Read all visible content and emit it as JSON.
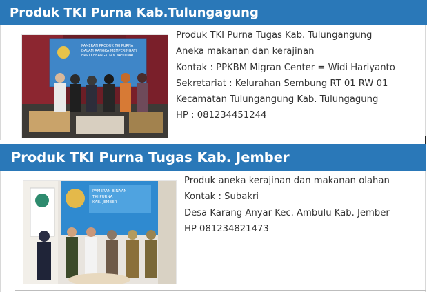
{
  "section1": {
    "title": "Produk TKI Purna Kab.Tulungagung",
    "lines": [
      "Produk TKI Purna Tugas Kab. Tulungangung",
      "Aneka makanan dan kerajinan",
      "Kontak : PPKBM Migran Center = Widi Hariyanto",
      "Sekretariat : Kelurahan Sembung RT 01 RW 01",
      "Kecamatan Tulungangung Kab. Tulungagung",
      "HP : 081234451244"
    ],
    "photo": {
      "banner_lines": [
        "PAMERAN PRODUK TKI PURNA",
        "DALAM RANGKA MEMPERINGATI",
        "HARI KEBANGKITAN NASIONAL"
      ],
      "icon": "exhibition-photo"
    }
  },
  "section2": {
    "title": "Produk TKI Purna Tugas Kab. Jember",
    "lines": [
      "Produk aneka kerajinan dan makanan olahan",
      "Kontak : Subakri",
      "Desa Karang Anyar Kec. Ambulu Kab. Jember",
      "HP 081234821473"
    ],
    "photo": {
      "banner_lines": [
        "PAMERAN BINAAN",
        "TKI PURNA",
        "KAB. JEMBER"
      ],
      "icon": "exhibition-photo"
    }
  },
  "colors": {
    "header_bg": "#2a78b8",
    "header_text": "#ffffff",
    "body_text": "#333333"
  }
}
